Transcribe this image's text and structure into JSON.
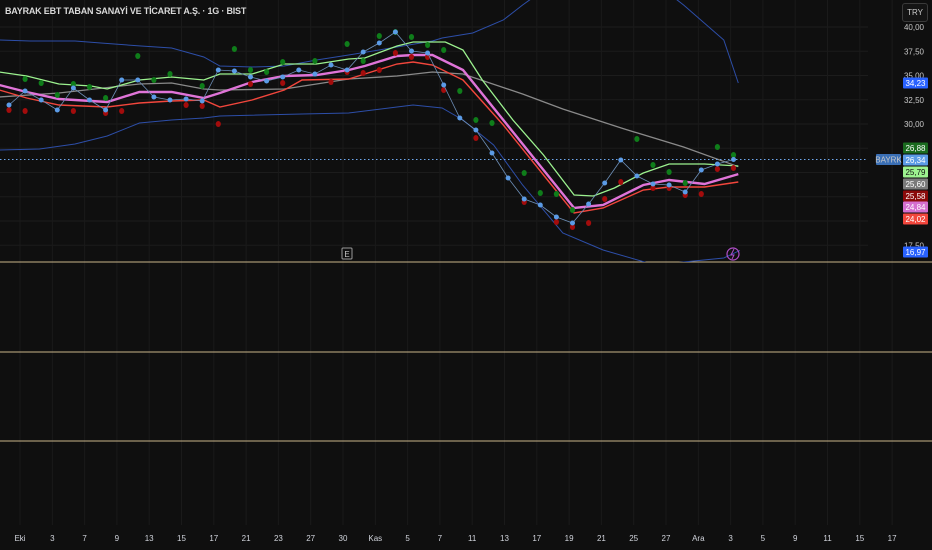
{
  "header": {
    "title": "BAYRAK EBT TABAN SANAYİ VE TİCARET A.Ş. · 1G · BIST",
    "currency": "TRY",
    "symbol_tag": "BAYRK"
  },
  "markers": {
    "earnings": "E"
  },
  "colors": {
    "bg": "#0f0f0f",
    "close": "#5b9be6",
    "upper_ma": "#9cf28f",
    "mid_ma": "#e074d8",
    "low_ma": "#f2463c",
    "slow_ma": "#8a8a8a",
    "bands": "#2d4ea8",
    "up_dot": "#0f7d1a",
    "down_dot": "#a30c0c",
    "separator": "#c9b48a"
  },
  "chart_data": {
    "type": "line",
    "title": "BAYRAK EBT TABAN SANAYİ VE TİCARET A.Ş. · 1G · BIST",
    "ylim": [
      15,
      42
    ],
    "y_ticks": [
      "40,00",
      "37,50",
      "35,00",
      "32,50",
      "30,00",
      "17,50"
    ],
    "y_tick_values": [
      40,
      37.5,
      35,
      32.5,
      30,
      17.5
    ],
    "x_ticks": [
      "Eki",
      "3",
      "7",
      "9",
      "13",
      "15",
      "17",
      "21",
      "23",
      "27",
      "30",
      "Kas",
      "5",
      "7",
      "11",
      "13",
      "17",
      "19",
      "21",
      "25",
      "27",
      "Ara",
      "3",
      "5",
      "9",
      "11",
      "15",
      "17"
    ],
    "last_price": 26.34,
    "price_labels": [
      {
        "value": "34,23",
        "color": "#2962ff"
      },
      {
        "value": "26,88",
        "color": "#1a6b1f"
      },
      {
        "value": "26,34",
        "color": "#5b9be6"
      },
      {
        "value": "25,79",
        "color": "#9cf28f",
        "text": "#0f0f0f"
      },
      {
        "value": "25,60",
        "color": "#7a7a7a"
      },
      {
        "value": "25,58",
        "color": "#8b0b0b"
      },
      {
        "value": "24,84",
        "color": "#d56fd0"
      },
      {
        "value": "24,02",
        "color": "#f2463c"
      },
      {
        "value": "16,97",
        "color": "#2962ff"
      }
    ],
    "series": [
      {
        "name": "close",
        "values": [
          31.96,
          33.4,
          32.47,
          31.44,
          33.71,
          32.47,
          31.44,
          34.54,
          34.54,
          32.78,
          32.47,
          32.58,
          32.37,
          35.57,
          35.46,
          34.85,
          34.43,
          34.85,
          35.57,
          35.15,
          36.08,
          35.57,
          37.42,
          38.35,
          39.48,
          37.53,
          37.32,
          34.02,
          30.62,
          29.38,
          27.01,
          24.43,
          22.27,
          21.65,
          20.41,
          19.79,
          21.75,
          23.92,
          26.29,
          24.64,
          23.81,
          23.71,
          22.99,
          25.26,
          25.88,
          26.34
        ]
      },
      {
        "name": "upper_ma",
        "points": [
          [
            -0.6,
            35.36
          ],
          [
            1.1,
            34.95
          ],
          [
            3.1,
            34.12
          ],
          [
            5.1,
            33.92
          ],
          [
            6.1,
            33.61
          ],
          [
            8.1,
            34.54
          ],
          [
            10.1,
            34.85
          ],
          [
            12.1,
            34.54
          ],
          [
            13.1,
            35.15
          ],
          [
            15.1,
            35.15
          ],
          [
            17.1,
            36.19
          ],
          [
            19.1,
            36.19
          ],
          [
            21.1,
            36.7
          ],
          [
            22.1,
            36.8
          ],
          [
            24.1,
            38.04
          ],
          [
            25.1,
            38.45
          ],
          [
            27.1,
            38.45
          ],
          [
            28.2,
            37.63
          ],
          [
            29.4,
            34.54
          ],
          [
            31.3,
            30.41
          ],
          [
            33.2,
            26.8
          ],
          [
            35.1,
            22.68
          ],
          [
            36.3,
            22.58
          ],
          [
            37.6,
            23.4
          ],
          [
            39.4,
            24.95
          ],
          [
            41,
            25.88
          ],
          [
            43.2,
            25.88
          ],
          [
            45.3,
            25.67
          ]
        ]
      },
      {
        "name": "mid_ma",
        "points": [
          [
            -0.6,
            34.02
          ],
          [
            1.1,
            33.3
          ],
          [
            3.1,
            32.58
          ],
          [
            6.1,
            32.27
          ],
          [
            8.1,
            33.3
          ],
          [
            10.1,
            33.3
          ],
          [
            12.1,
            32.68
          ],
          [
            13.1,
            33.2
          ],
          [
            15.1,
            34.33
          ],
          [
            17.1,
            34.95
          ],
          [
            19.1,
            35.05
          ],
          [
            21.1,
            35.57
          ],
          [
            22.1,
            35.98
          ],
          [
            24.1,
            37.01
          ],
          [
            25.1,
            37.11
          ],
          [
            26.3,
            37.11
          ],
          [
            28.2,
            35.57
          ],
          [
            30.7,
            30.41
          ],
          [
            33.2,
            25.26
          ],
          [
            35.1,
            21.34
          ],
          [
            36.9,
            21.65
          ],
          [
            39.4,
            23.71
          ],
          [
            41,
            24.23
          ],
          [
            43.2,
            23.81
          ],
          [
            45.3,
            24.84
          ]
        ]
      },
      {
        "name": "low_ma",
        "points": [
          [
            -0.6,
            33.51
          ],
          [
            1.1,
            32.68
          ],
          [
            3.1,
            31.96
          ],
          [
            6.1,
            31.75
          ],
          [
            8.1,
            32.16
          ],
          [
            10.1,
            32.37
          ],
          [
            12.1,
            32.47
          ],
          [
            13.1,
            31.75
          ],
          [
            15.1,
            32.47
          ],
          [
            17.1,
            33.51
          ],
          [
            18.2,
            34.54
          ],
          [
            21.1,
            34.64
          ],
          [
            22.1,
            35.15
          ],
          [
            24.1,
            36.19
          ],
          [
            25.1,
            36.39
          ],
          [
            26.3,
            36.08
          ],
          [
            28.2,
            34.54
          ],
          [
            30.7,
            29.9
          ],
          [
            33.2,
            24.74
          ],
          [
            35.1,
            20.82
          ],
          [
            36.9,
            21.34
          ],
          [
            39.4,
            23.2
          ],
          [
            41,
            23.51
          ],
          [
            43.2,
            23.51
          ],
          [
            45.3,
            24.02
          ]
        ]
      },
      {
        "name": "slow_ma",
        "points": [
          [
            -0.6,
            32.78
          ],
          [
            3.1,
            33.2
          ],
          [
            8.1,
            34.12
          ],
          [
            10.1,
            34.23
          ],
          [
            12.1,
            33.61
          ],
          [
            13.1,
            33.51
          ],
          [
            17.1,
            33.61
          ],
          [
            21.1,
            34.64
          ],
          [
            24.1,
            34.95
          ],
          [
            26.3,
            35.36
          ],
          [
            28.2,
            35.15
          ],
          [
            31.9,
            33.09
          ],
          [
            34.4,
            31.55
          ],
          [
            38.2,
            29.49
          ],
          [
            41.9,
            27.63
          ],
          [
            45.3,
            25.6
          ]
        ]
      },
      {
        "name": "upper_band",
        "points": [
          [
            -0.6,
            38.66
          ],
          [
            1.3,
            38.56
          ],
          [
            4.1,
            38.56
          ],
          [
            5.7,
            38.35
          ],
          [
            8.2,
            38.04
          ],
          [
            10.1,
            37.84
          ],
          [
            12.1,
            36.91
          ],
          [
            13.1,
            35.98
          ],
          [
            15.1,
            35.88
          ],
          [
            17.1,
            35.98
          ],
          [
            19.1,
            36.6
          ],
          [
            21.1,
            37.11
          ],
          [
            24.1,
            37.94
          ],
          [
            26.3,
            38.56
          ],
          [
            26.9,
            38.87
          ],
          [
            28.8,
            39.38
          ],
          [
            30.7,
            40.72
          ],
          [
            31.9,
            42.27
          ],
          [
            33.2,
            43.81
          ],
          [
            40.7,
            43.81
          ],
          [
            41.9,
            42.27
          ],
          [
            44.4,
            38.66
          ],
          [
            45.3,
            34.23
          ]
        ]
      },
      {
        "name": "lower_band",
        "points": [
          [
            -0.6,
            27.32
          ],
          [
            1.9,
            27.42
          ],
          [
            4.1,
            27.94
          ],
          [
            6.1,
            28.76
          ],
          [
            8.1,
            30.1
          ],
          [
            10.1,
            30.41
          ],
          [
            12.1,
            30.62
          ],
          [
            13.1,
            30.82
          ],
          [
            18.2,
            31.03
          ],
          [
            21.1,
            31.13
          ],
          [
            24.1,
            31.75
          ],
          [
            25.1,
            31.96
          ],
          [
            26.9,
            31.65
          ],
          [
            28.2,
            30.41
          ],
          [
            30.1,
            27.84
          ],
          [
            31.9,
            23.71
          ],
          [
            34.4,
            18.76
          ],
          [
            36.9,
            17.01
          ],
          [
            40.1,
            15.47
          ],
          [
            44.4,
            16.19
          ],
          [
            45.4,
            16.97
          ]
        ]
      }
    ],
    "up_dots": [
      [
        1,
        34.64
      ],
      [
        2,
        34.23
      ],
      [
        3,
        32.99
      ],
      [
        4,
        34.12
      ],
      [
        5,
        33.81
      ],
      [
        6,
        32.68
      ],
      [
        8,
        37.01
      ],
      [
        9,
        34.54
      ],
      [
        10,
        35.15
      ],
      [
        12,
        33.92
      ],
      [
        14,
        37.73
      ],
      [
        15,
        35.57
      ],
      [
        16,
        35.36
      ],
      [
        17,
        36.39
      ],
      [
        19,
        36.49
      ],
      [
        21,
        38.25
      ],
      [
        22,
        36.49
      ],
      [
        23,
        39.07
      ],
      [
        24,
        39.48
      ],
      [
        25,
        38.97
      ],
      [
        26,
        38.14
      ],
      [
        27,
        37.63
      ],
      [
        28,
        33.4
      ],
      [
        29,
        30.41
      ],
      [
        30,
        30.1
      ],
      [
        32,
        24.95
      ],
      [
        33,
        22.89
      ],
      [
        34,
        22.78
      ],
      [
        35,
        21.13
      ],
      [
        39,
        28.45
      ],
      [
        40,
        25.77
      ],
      [
        41,
        25.05
      ],
      [
        42,
        23.92
      ],
      [
        44,
        27.63
      ],
      [
        45,
        26.8
      ]
    ],
    "down_dots": [
      [
        0,
        31.44
      ],
      [
        1,
        31.34
      ],
      [
        4,
        31.34
      ],
      [
        6,
        31.13
      ],
      [
        7,
        31.34
      ],
      [
        11,
        31.96
      ],
      [
        12,
        31.86
      ],
      [
        13,
        30
      ],
      [
        15,
        34.12
      ],
      [
        17,
        34.23
      ],
      [
        20,
        34.33
      ],
      [
        21,
        35.36
      ],
      [
        22,
        35.26
      ],
      [
        23,
        35.57
      ],
      [
        24,
        37.32
      ],
      [
        25,
        36.91
      ],
      [
        26,
        36.91
      ],
      [
        27,
        33.51
      ],
      [
        29,
        28.56
      ],
      [
        32,
        21.96
      ],
      [
        34,
        19.9
      ],
      [
        35,
        19.38
      ],
      [
        36,
        19.79
      ],
      [
        37,
        22.27
      ],
      [
        38,
        24.02
      ],
      [
        40,
        23.4
      ],
      [
        41,
        23.4
      ],
      [
        42,
        22.68
      ],
      [
        43,
        22.78
      ],
      [
        44,
        25.36
      ],
      [
        45,
        25.46
      ]
    ]
  }
}
